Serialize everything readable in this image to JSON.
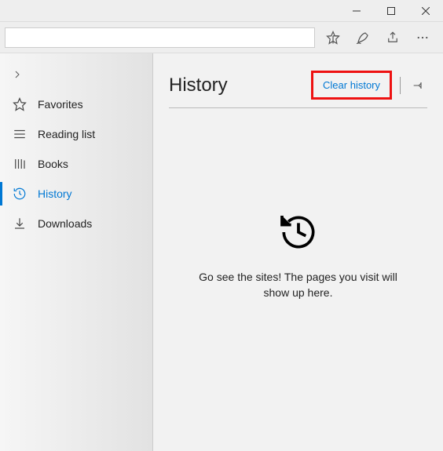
{
  "sidebar": {
    "items": [
      {
        "label": "Favorites"
      },
      {
        "label": "Reading list"
      },
      {
        "label": "Books"
      },
      {
        "label": "History"
      },
      {
        "label": "Downloads"
      }
    ]
  },
  "content": {
    "title": "History",
    "clear_label": "Clear history",
    "empty_message": "Go see the sites! The pages you visit will show up here."
  }
}
